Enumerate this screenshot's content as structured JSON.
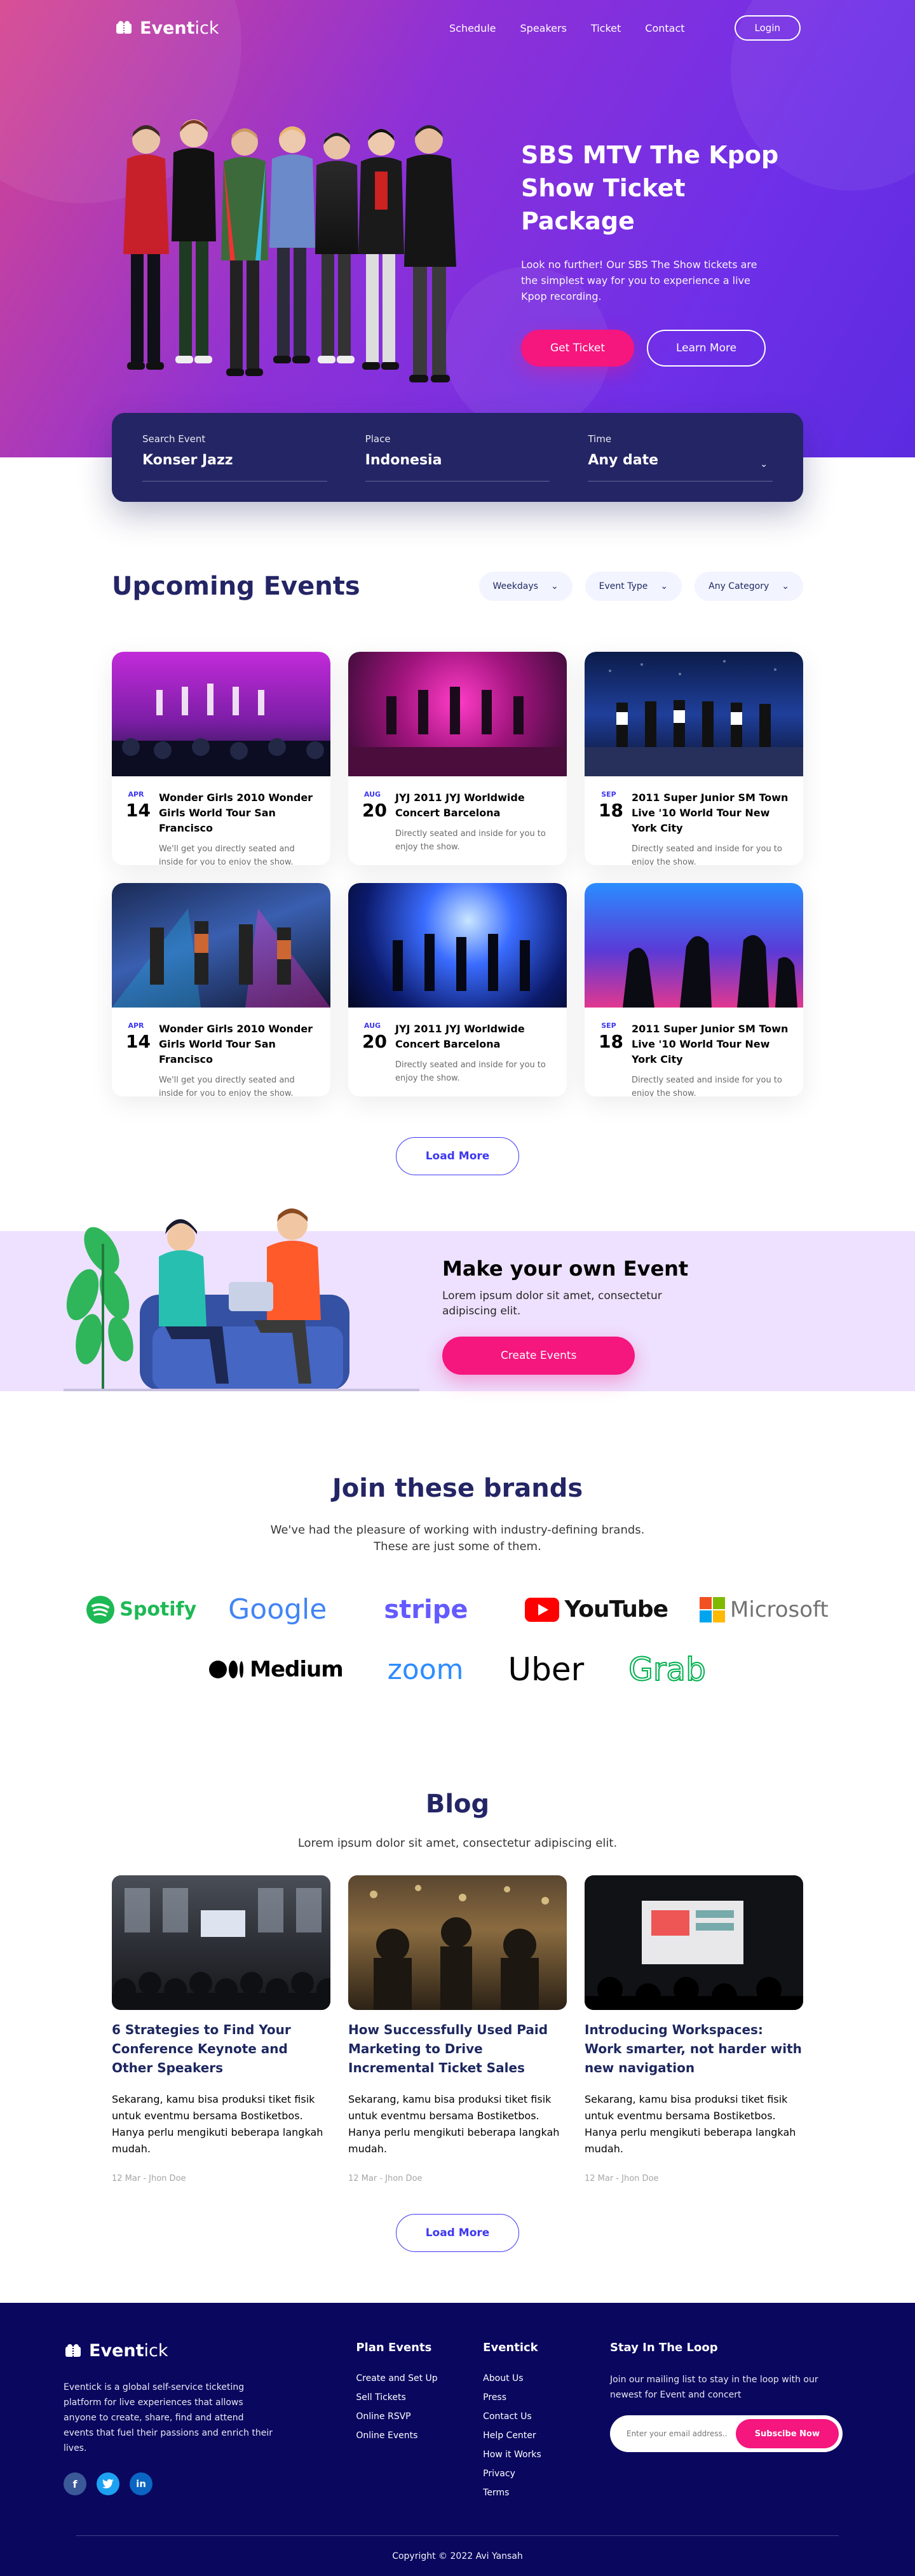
{
  "brand": {
    "name_a": "Event",
    "name_b": "ick"
  },
  "nav": {
    "items": [
      "Schedule",
      "Speakers",
      "Ticket",
      "Contact"
    ],
    "login": "Login"
  },
  "hero": {
    "title": "SBS MTV The Kpop Show Ticket  Package",
    "text": "Look no further! Our SBS The Show tickets are the simplest way for you to experience a live Kpop recording.",
    "cta_primary": "Get Ticket",
    "cta_secondary": "Learn More"
  },
  "search": {
    "event": {
      "label": "Search Event",
      "value": "Konser Jazz"
    },
    "place": {
      "label": "Place",
      "value": "Indonesia"
    },
    "time": {
      "label": "Time",
      "value": "Any date"
    }
  },
  "upcoming": {
    "title": "Upcoming Events",
    "filters": [
      "Weekdays",
      "Event Type",
      "Any Category"
    ],
    "events": [
      {
        "month": "APR",
        "day": "14",
        "title": "Wonder Girls 2010 Wonder Girls World Tour San Francisco",
        "desc": "We'll get you directly seated and inside for you to enjoy the show."
      },
      {
        "month": "AUG",
        "day": "20",
        "title": "JYJ 2011 JYJ Worldwide Concert Barcelona",
        "desc": "Directly seated and inside for you to enjoy the show."
      },
      {
        "month": "SEP",
        "day": "18",
        "title": "2011 Super Junior SM Town Live '10 World Tour New York City",
        "desc": "Directly seated and inside for you to enjoy the show."
      },
      {
        "month": "APR",
        "day": "14",
        "title": "Wonder Girls 2010 Wonder Girls World Tour San Francisco",
        "desc": "We'll get you directly seated and inside for you to enjoy the show."
      },
      {
        "month": "AUG",
        "day": "20",
        "title": "JYJ 2011 JYJ Worldwide Concert Barcelona",
        "desc": "Directly seated and inside for you to enjoy the show."
      },
      {
        "month": "SEP",
        "day": "18",
        "title": "2011 Super Junior SM Town Live '10 World Tour New York City",
        "desc": "Directly seated and inside for you to enjoy the show."
      }
    ],
    "load_more": "Load More"
  },
  "make_event": {
    "title": "Make your own Event",
    "text": "Lorem ipsum dolor sit amet, consectetur adipiscing elit.",
    "cta": "Create Events"
  },
  "brands": {
    "title": "Join these brands",
    "text": "We've had the pleasure of working with industry-defining brands. These are just some of them.",
    "logos": [
      "Spotify",
      "Google",
      "stripe",
      "YouTube",
      "Microsoft",
      "Medium",
      "zoom",
      "Uber",
      "Grab"
    ]
  },
  "blog": {
    "title": "Blog",
    "subtitle": "Lorem ipsum dolor sit amet, consectetur adipiscing elit.",
    "posts": [
      {
        "title": "6 Strategies to Find Your Conference Keynote and Other Speakers",
        "desc": "Sekarang, kamu bisa produksi tiket fisik untuk eventmu bersama Bostiketbos. Hanya perlu mengikuti beberapa langkah mudah.",
        "meta": "12 Mar - Jhon Doe"
      },
      {
        "title": "How Successfully Used Paid Marketing to Drive Incremental Ticket Sales",
        "desc": "Sekarang, kamu bisa produksi tiket fisik untuk eventmu bersama Bostiketbos. Hanya perlu mengikuti beberapa langkah mudah.",
        "meta": "12 Mar - Jhon Doe"
      },
      {
        "title": "Introducing Workspaces: Work smarter, not harder with new navigation",
        "desc": "Sekarang, kamu bisa produksi tiket fisik untuk eventmu bersama Bostiketbos. Hanya perlu mengikuti beberapa langkah mudah.",
        "meta": "12 Mar - Jhon Doe"
      }
    ],
    "load_more": "Load More"
  },
  "footer": {
    "about": "Eventick is a global self-service ticketing platform for live experiences that allows anyone to create, share, find and attend events that fuel their passions and enrich their lives.",
    "plan_title": "Plan Events",
    "plan_items": [
      "Create and Set Up",
      "Sell Tickets",
      "Online RSVP",
      "Online Events"
    ],
    "company_title": "Eventick",
    "company_items": [
      "About Us",
      "Press",
      "Contact Us",
      "Help Center",
      "How it Works",
      "Privacy",
      "Terms"
    ],
    "news_title": "Stay In The Loop",
    "news_text": "Join our mailing list to stay in the loop with our newest for Event and concert",
    "email_placeholder": "Enter your email address..",
    "subscribe": "Subscibe Now",
    "copyright": "Copyright © 2022 Avi Yansah"
  },
  "colors": {
    "primary": "#242565",
    "accent": "#f5167e",
    "blue": "#3d37f1",
    "footer": "#0a075f"
  }
}
